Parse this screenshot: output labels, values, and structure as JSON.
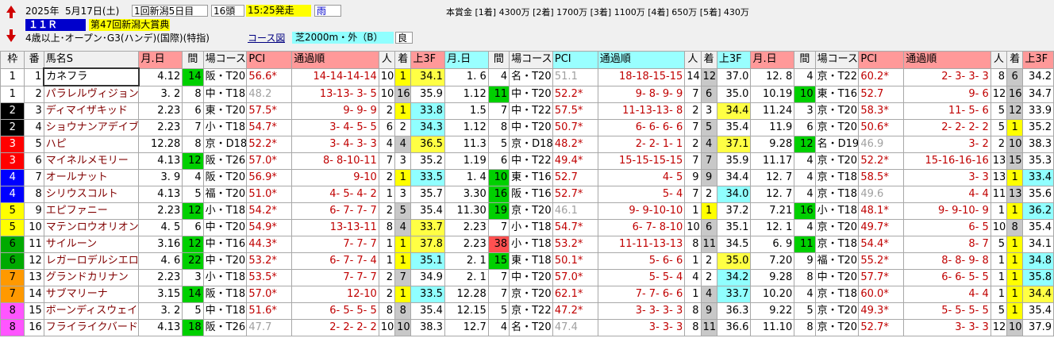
{
  "header": {
    "year": "2025年",
    "date": "5月17日(土)",
    "meeting": "1回新潟5日目",
    "count": "16頭",
    "start": "15:25発走",
    "weather": "雨",
    "prize": "本賞金 [1着] 4300万 [2着] 1700万 [3着] 1100万 [4着] 650万 [5着] 430万",
    "race_no": "１１Ｒ",
    "race_name": "第47回新潟大賞典",
    "conditions": "4歳以上･オープン･G3(ハンデ)(国際)(特指)",
    "course_label": "コース図",
    "course": "芝2000m・外（B）",
    "going": "良"
  },
  "columns": {
    "waku": "枠",
    "ban": "番",
    "name": "馬名S",
    "date": "月.日",
    "interval": "間",
    "course": "場コース",
    "pci": "PCI",
    "passage": "通過順",
    "pop": "人",
    "finish": "着",
    "last3f": "上3F"
  },
  "colors": {
    "waku": [
      "#ffffff",
      "#000000",
      "#ff0000",
      "#0000ff",
      "#ffff00",
      "#00aa00",
      "#ff9900",
      "#ff55ff"
    ]
  },
  "horses": [
    {
      "waku": "1",
      "ban": "1",
      "name": "カネフラ",
      "runs": [
        {
          "date": "4.12",
          "iv": "14",
          "c": "阪・T20",
          "pci": "56.6*",
          "pm": "r",
          "pass": "14-14-14-14",
          "pop": "10",
          "fin": "1",
          "l3": "34.1",
          "l3m": "p1"
        },
        {
          "date": "1. 6",
          "iv": "4",
          "c": "名・T20",
          "pci": "51.1",
          "pm": "g",
          "pass": "18-18-15-15",
          "pop": "14",
          "fin": "12",
          "l3": "37.0",
          "l3m": ""
        },
        {
          "date": "12. 8",
          "iv": "4",
          "c": "京・T22",
          "pci": "60.2*",
          "pm": "r",
          "pass": "2- 3- 3- 3",
          "pop": "8",
          "fin": "6",
          "l3": "34.2",
          "l3m": ""
        }
      ]
    },
    {
      "waku": "1",
      "ban": "2",
      "name": "パラレルヴィジョン",
      "runs": [
        {
          "date": "3. 2",
          "iv": "8",
          "c": "中・T18",
          "pci": "48.2",
          "pm": "g",
          "pass": "13-13- 3- 5",
          "pop": "10",
          "fin": "16",
          "l3": "35.9",
          "l3m": ""
        },
        {
          "date": "1.12",
          "iv": "11",
          "c": "中・T20",
          "pci": "52.2*",
          "pm": "r",
          "pass": "9- 8- 9- 9",
          "pop": "7",
          "fin": "6",
          "l3": "35.0",
          "l3m": ""
        },
        {
          "date": "10.19",
          "iv": "10",
          "c": "東・T16",
          "pci": "52.7",
          "pm": "r",
          "pass": "9- 6",
          "pop": "12",
          "fin": "16",
          "l3": "34.7",
          "l3m": ""
        }
      ]
    },
    {
      "waku": "2",
      "ban": "3",
      "name": "ディマイザキッド",
      "runs": [
        {
          "date": "2.23",
          "iv": "6",
          "c": "東・T20",
          "pci": "57.5*",
          "pm": "r",
          "pass": "9- 9- 9",
          "pop": "2",
          "fin": "1",
          "l3": "33.8",
          "l3m": "p2"
        },
        {
          "date": "1.5",
          "iv": "7",
          "c": "中・T22",
          "pci": "57.5*",
          "pm": "r",
          "pass": "11-13-13- 8",
          "pop": "2",
          "fin": "3",
          "l3": "34.4",
          "l3m": "p1"
        },
        {
          "date": "11.24",
          "iv": "3",
          "c": "京・T20",
          "pci": "58.3*",
          "pm": "r",
          "pass": "11- 5- 6",
          "pop": "5",
          "fin": "12",
          "l3": "33.9",
          "l3m": ""
        }
      ]
    },
    {
      "waku": "2",
      "ban": "4",
      "name": "ショウナンアデイブ",
      "runs": [
        {
          "date": "2.23",
          "iv": "7",
          "c": "小・T18",
          "pci": "54.7*",
          "pm": "r",
          "pass": "3- 4- 5- 5",
          "pop": "6",
          "fin": "2",
          "l3": "34.3",
          "l3m": "p2"
        },
        {
          "date": "1.12",
          "iv": "8",
          "c": "中・T20",
          "pci": "50.7*",
          "pm": "r",
          "pass": "6- 6- 6- 6",
          "pop": "7",
          "fin": "5",
          "l3": "35.4",
          "l3m": ""
        },
        {
          "date": "11.9",
          "iv": "6",
          "c": "京・T20",
          "pci": "50.6*",
          "pm": "r",
          "pass": "2- 2- 2- 2",
          "pop": "5",
          "fin": "1",
          "l3": "35.2",
          "l3m": ""
        }
      ]
    },
    {
      "waku": "3",
      "ban": "5",
      "name": "ハピ",
      "runs": [
        {
          "date": "12.28",
          "iv": "8",
          "c": "京・D18",
          "pci": "52.2*",
          "pm": "r",
          "pass": "3- 4- 3- 3",
          "pop": "4",
          "fin": "4",
          "l3": "36.5",
          "l3m": "p1"
        },
        {
          "date": "11.3",
          "iv": "5",
          "c": "京・D18",
          "pci": "48.2*",
          "pm": "r",
          "pass": "2- 2- 1- 1",
          "pop": "2",
          "fin": "4",
          "l3": "37.1",
          "l3m": "p1"
        },
        {
          "date": "9.28",
          "iv": "12",
          "c": "名・D19",
          "pci": "46.9",
          "pm": "g",
          "pass": "3- 2",
          "pop": "2",
          "fin": "10",
          "l3": "38.3",
          "l3m": ""
        }
      ]
    },
    {
      "waku": "3",
      "ban": "6",
      "name": "マイネルメモリー",
      "runs": [
        {
          "date": "4.13",
          "iv": "12",
          "c": "阪・T26",
          "pci": "57.0*",
          "pm": "r",
          "pass": "8- 8-10-11",
          "pop": "7",
          "fin": "3",
          "l3": "35.2",
          "l3m": ""
        },
        {
          "date": "1.19",
          "iv": "6",
          "c": "中・T22",
          "pci": "49.4*",
          "pm": "r",
          "pass": "15-15-15-15",
          "pop": "7",
          "fin": "7",
          "l3": "35.9",
          "l3m": ""
        },
        {
          "date": "11.17",
          "iv": "4",
          "c": "京・T20",
          "pci": "52.2*",
          "pm": "r",
          "pass": "15-16-16-16",
          "pop": "13",
          "fin": "15",
          "l3": "35.3",
          "l3m": ""
        }
      ]
    },
    {
      "waku": "4",
      "ban": "7",
      "name": "オールナット",
      "runs": [
        {
          "date": "3. 9",
          "iv": "4",
          "c": "阪・T20",
          "pci": "56.9*",
          "pm": "r",
          "pass": "9-10",
          "pop": "2",
          "fin": "1",
          "l3": "33.5",
          "l3m": "p2"
        },
        {
          "date": "1. 4",
          "iv": "10",
          "c": "東・T16",
          "pci": "52.7",
          "pm": "r",
          "pass": "4- 5",
          "pop": "9",
          "fin": "9",
          "l3": "34.4",
          "l3m": ""
        },
        {
          "date": "12. 7",
          "iv": "4",
          "c": "京・T18",
          "pci": "58.5*",
          "pm": "r",
          "pass": "3- 3",
          "pop": "13",
          "fin": "1",
          "l3": "33.4",
          "l3m": "p2"
        }
      ]
    },
    {
      "waku": "4",
      "ban": "8",
      "name": "シリウスコルト",
      "runs": [
        {
          "date": "4.13",
          "iv": "5",
          "c": "福・T20",
          "pci": "51.0*",
          "pm": "r",
          "pass": "4- 5- 4- 2",
          "pop": "1",
          "fin": "3",
          "l3": "35.7",
          "l3m": ""
        },
        {
          "date": "3.30",
          "iv": "16",
          "c": "阪・T16",
          "pci": "52.7*",
          "pm": "r",
          "pass": "5- 4",
          "pop": "7",
          "fin": "2",
          "l3": "34.0",
          "l3m": "p2"
        },
        {
          "date": "12. 7",
          "iv": "4",
          "c": "京・T18",
          "pci": "49.6",
          "pm": "g",
          "pass": "4- 4",
          "pop": "11",
          "fin": "13",
          "l3": "35.6",
          "l3m": ""
        }
      ]
    },
    {
      "waku": "5",
      "ban": "9",
      "name": "エピファニー",
      "runs": [
        {
          "date": "2.23",
          "iv": "12",
          "c": "小・T18",
          "pci": "54.2*",
          "pm": "r",
          "pass": "6- 7- 7- 7",
          "pop": "2",
          "fin": "5",
          "l3": "35.4",
          "l3m": ""
        },
        {
          "date": "11.30",
          "iv": "19",
          "c": "京・T20",
          "pci": "46.1",
          "pm": "g",
          "pass": "9- 9-10-10",
          "pop": "1",
          "fin": "1",
          "l3": "37.2",
          "l3m": ""
        },
        {
          "date": "7.21",
          "iv": "16",
          "c": "小・T18",
          "pci": "48.1*",
          "pm": "r",
          "pass": "9- 9-10- 9",
          "pop": "1",
          "fin": "1",
          "l3": "36.2",
          "l3m": "p2"
        }
      ]
    },
    {
      "waku": "5",
      "ban": "10",
      "name": "マテンロウオリオン",
      "runs": [
        {
          "date": "4. 5",
          "iv": "6",
          "c": "中・T20",
          "pci": "54.9*",
          "pm": "r",
          "pass": "13-13-11",
          "pop": "8",
          "fin": "4",
          "l3": "33.7",
          "l3m": "p1"
        },
        {
          "date": "2.23",
          "iv": "7",
          "c": "小・T18",
          "pci": "54.7*",
          "pm": "r",
          "pass": "6- 7- 8-10",
          "pop": "10",
          "fin": "6",
          "l3": "35.1",
          "l3m": ""
        },
        {
          "date": "12. 1",
          "iv": "4",
          "c": "京・T20",
          "pci": "49.7*",
          "pm": "r",
          "pass": "6- 5",
          "pop": "10",
          "fin": "8",
          "l3": "35.4",
          "l3m": ""
        }
      ]
    },
    {
      "waku": "6",
      "ban": "11",
      "name": "サイルーン",
      "runs": [
        {
          "date": "3.16",
          "iv": "12",
          "c": "中・T16",
          "pci": "44.3*",
          "pm": "r",
          "pass": "7- 7- 7",
          "pop": "1",
          "fin": "1",
          "l3": "37.8",
          "l3m": "p1"
        },
        {
          "date": "2.23",
          "iv": "38",
          "c": "小・T18",
          "pci": "53.2*",
          "pm": "r",
          "pass": "11-11-13-13",
          "pop": "8",
          "fin": "11",
          "l3": "34.5",
          "l3m": ""
        },
        {
          "date": "6. 9",
          "iv": "11",
          "c": "京・T18",
          "pci": "54.4*",
          "pm": "r",
          "pass": "8- 7",
          "pop": "5",
          "fin": "1",
          "l3": "34.1",
          "l3m": ""
        }
      ]
    },
    {
      "waku": "6",
      "ban": "12",
      "name": "レガーロデルシエロ",
      "runs": [
        {
          "date": "4. 6",
          "iv": "22",
          "c": "中・T20",
          "pci": "53.2*",
          "pm": "r",
          "pass": "6- 7- 7- 4",
          "pop": "1",
          "fin": "1",
          "l3": "35.1",
          "l3m": "p2"
        },
        {
          "date": "2. 1",
          "iv": "15",
          "c": "東・T18",
          "pci": "50.1*",
          "pm": "r",
          "pass": "5- 6- 6",
          "pop": "1",
          "fin": "2",
          "l3": "35.0",
          "l3m": "p1"
        },
        {
          "date": "7.20",
          "iv": "9",
          "c": "福・T20",
          "pci": "55.2*",
          "pm": "r",
          "pass": "8- 8- 9- 8",
          "pop": "1",
          "fin": "1",
          "l3": "34.8",
          "l3m": "p2"
        }
      ]
    },
    {
      "waku": "7",
      "ban": "13",
      "name": "グランドカリナン",
      "runs": [
        {
          "date": "2.23",
          "iv": "3",
          "c": "小・T18",
          "pci": "53.5*",
          "pm": "r",
          "pass": "7- 7- 7",
          "pop": "2",
          "fin": "7",
          "l3": "34.9",
          "l3m": ""
        },
        {
          "date": "2. 1",
          "iv": "7",
          "c": "中・T20",
          "pci": "57.0*",
          "pm": "r",
          "pass": "5- 5- 4",
          "pop": "4",
          "fin": "2",
          "l3": "34.2",
          "l3m": "p2"
        },
        {
          "date": "9.28",
          "iv": "8",
          "c": "中・T20",
          "pci": "57.7*",
          "pm": "r",
          "pass": "6- 6- 5- 5",
          "pop": "1",
          "fin": "1",
          "l3": "35.8",
          "l3m": "p2"
        }
      ]
    },
    {
      "waku": "7",
      "ban": "14",
      "name": "サブマリーナ",
      "runs": [
        {
          "date": "3.15",
          "iv": "14",
          "c": "阪・T18",
          "pci": "57.0*",
          "pm": "r",
          "pass": "12-10",
          "pop": "2",
          "fin": "1",
          "l3": "33.5",
          "l3m": "p2"
        },
        {
          "date": "12.28",
          "iv": "7",
          "c": "京・T20",
          "pci": "62.1*",
          "pm": "r",
          "pass": "7- 7- 6- 6",
          "pop": "1",
          "fin": "4",
          "l3": "33.7",
          "l3m": "p2"
        },
        {
          "date": "10.20",
          "iv": "4",
          "c": "京・T18",
          "pci": "60.0*",
          "pm": "r",
          "pass": "4- 4",
          "pop": "1",
          "fin": "1",
          "l3": "34.4",
          "l3m": "p1"
        }
      ]
    },
    {
      "waku": "8",
      "ban": "15",
      "name": "ボーンディスウェイ",
      "runs": [
        {
          "date": "3. 2",
          "iv": "5",
          "c": "中・T18",
          "pci": "51.6*",
          "pm": "r",
          "pass": "6- 5- 5- 5",
          "pop": "8",
          "fin": "8",
          "l3": "35.4",
          "l3m": ""
        },
        {
          "date": "12.15",
          "iv": "5",
          "c": "京・T22",
          "pci": "47.2*",
          "pm": "r",
          "pass": "3- 3- 3- 3",
          "pop": "8",
          "fin": "9",
          "l3": "36.3",
          "l3m": ""
        },
        {
          "date": "9.22",
          "iv": "5",
          "c": "京・T20",
          "pci": "49.3*",
          "pm": "r",
          "pass": "5- 5- 5- 5",
          "pop": "5",
          "fin": "1",
          "l3": "35.4",
          "l3m": ""
        }
      ]
    },
    {
      "waku": "8",
      "ban": "16",
      "name": "フライライクバード",
      "runs": [
        {
          "date": "4.13",
          "iv": "18",
          "c": "阪・T26",
          "pci": "47.7",
          "pm": "g",
          "pass": "2- 2- 2- 2",
          "pop": "10",
          "fin": "10",
          "l3": "38.3",
          "l3m": ""
        },
        {
          "date": "12.7",
          "iv": "4",
          "c": "名・T20",
          "pci": "47.4",
          "pm": "g",
          "pass": "3- 3- 3",
          "pop": "8",
          "fin": "11",
          "l3": "36.6",
          "l3m": ""
        },
        {
          "date": "11.10",
          "iv": "8",
          "c": "京・T20",
          "pci": "52.7*",
          "pm": "r",
          "pass": "3- 3- 3",
          "pop": "12",
          "fin": "10",
          "l3": "37.9",
          "l3m": ""
        }
      ]
    }
  ]
}
